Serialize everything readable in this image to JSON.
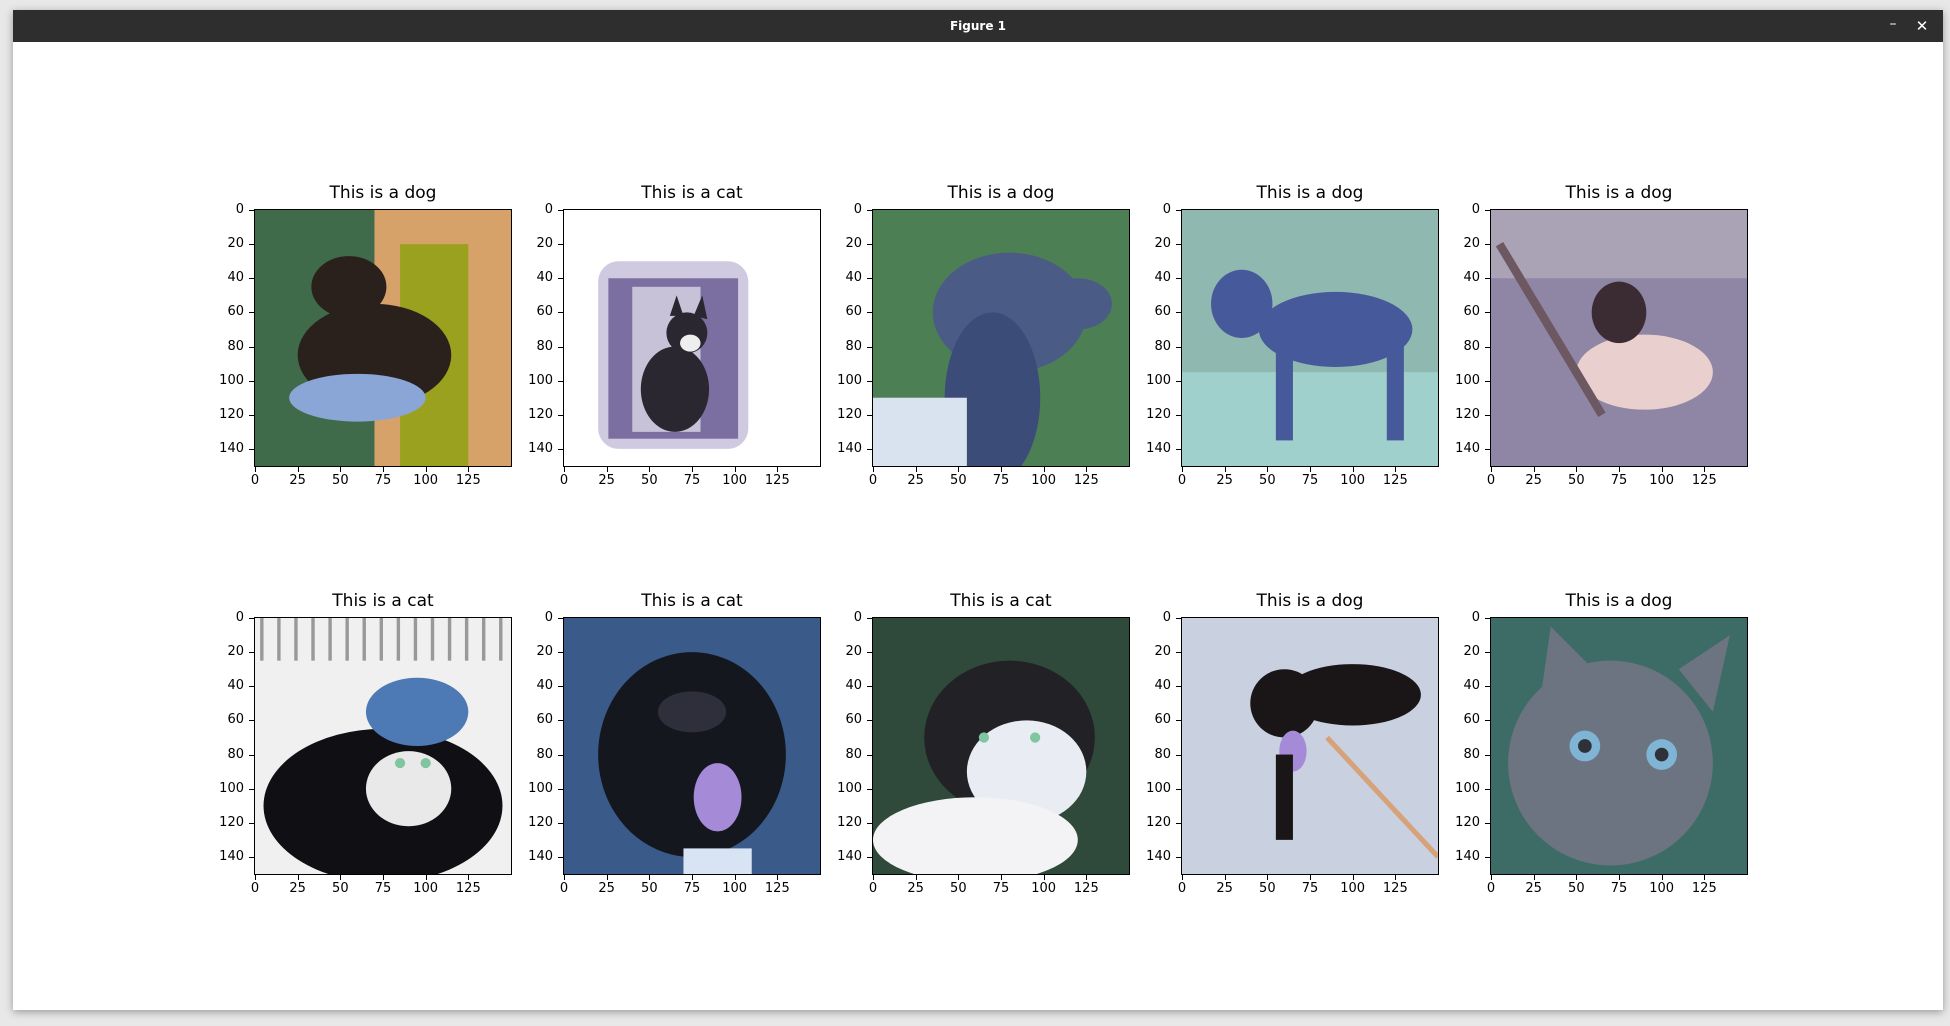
{
  "window": {
    "title": "Figure 1",
    "minimize_glyph": "–",
    "close_glyph": "✕"
  },
  "figure": {
    "y_ticks": [
      "0",
      "20",
      "40",
      "60",
      "80",
      "100",
      "120",
      "140"
    ],
    "x_ticks": [
      "0",
      "25",
      "50",
      "75",
      "100",
      "125"
    ],
    "image_size": 150,
    "subplots": [
      {
        "title": "This is a dog",
        "scene": "dog-held-by-person",
        "palette": {
          "bg": "#3f6b4a",
          "accent": "#d6a26a",
          "subject": "#2a211c",
          "secondary": "#8aa6d6"
        }
      },
      {
        "title": "This is a cat",
        "scene": "cat-vignette-white",
        "palette": {
          "bg": "#ffffff",
          "accent": "#7a6fa0",
          "subject": "#2a2730",
          "secondary": "#a79fc6"
        }
      },
      {
        "title": "This is a dog",
        "scene": "hound-profile",
        "palette": {
          "bg": "#4c7f54",
          "accent": "#a7b7c8",
          "subject": "#4a5b86",
          "secondary": "#d9e2ef"
        }
      },
      {
        "title": "This is a dog",
        "scene": "blue-heeler-standing",
        "palette": {
          "bg": "#8fb8b0",
          "accent": "#d8c8a4",
          "subject": "#46599a",
          "secondary": "#2b3560"
        }
      },
      {
        "title": "This is a dog",
        "scene": "beagle-lying",
        "palette": {
          "bg": "#8e86a4",
          "accent": "#e9d0cf",
          "subject": "#3b2b33",
          "secondary": "#b9b3c9"
        }
      },
      {
        "title": "This is a cat",
        "scene": "tuxedo-cat-cage",
        "palette": {
          "bg": "#f0f0f0",
          "accent": "#4d79b4",
          "subject": "#101014",
          "secondary": "#e9e9e9"
        }
      },
      {
        "title": "This is a cat",
        "scene": "black-dog-tongue",
        "palette": {
          "bg": "#3a5a8a",
          "accent": "#a58ad8",
          "subject": "#15171f",
          "secondary": "#d8e4f4"
        }
      },
      {
        "title": "This is a cat",
        "scene": "white-black-cat-cage",
        "palette": {
          "bg": "#2f4a3a",
          "accent": "#e9ecf2",
          "subject": "#222226",
          "secondary": "#97a6c6"
        }
      },
      {
        "title": "This is a dog",
        "scene": "black-puppy-leash",
        "palette": {
          "bg": "#c9d0e0",
          "accent": "#a58ad8",
          "subject": "#1a1618",
          "secondary": "#d6a27a"
        }
      },
      {
        "title": "This is a dog",
        "scene": "tabby-kitten",
        "palette": {
          "bg": "#3d6b66",
          "accent": "#7fb4d4",
          "subject": "#6b7480",
          "secondary": "#2e3238"
        }
      }
    ]
  }
}
